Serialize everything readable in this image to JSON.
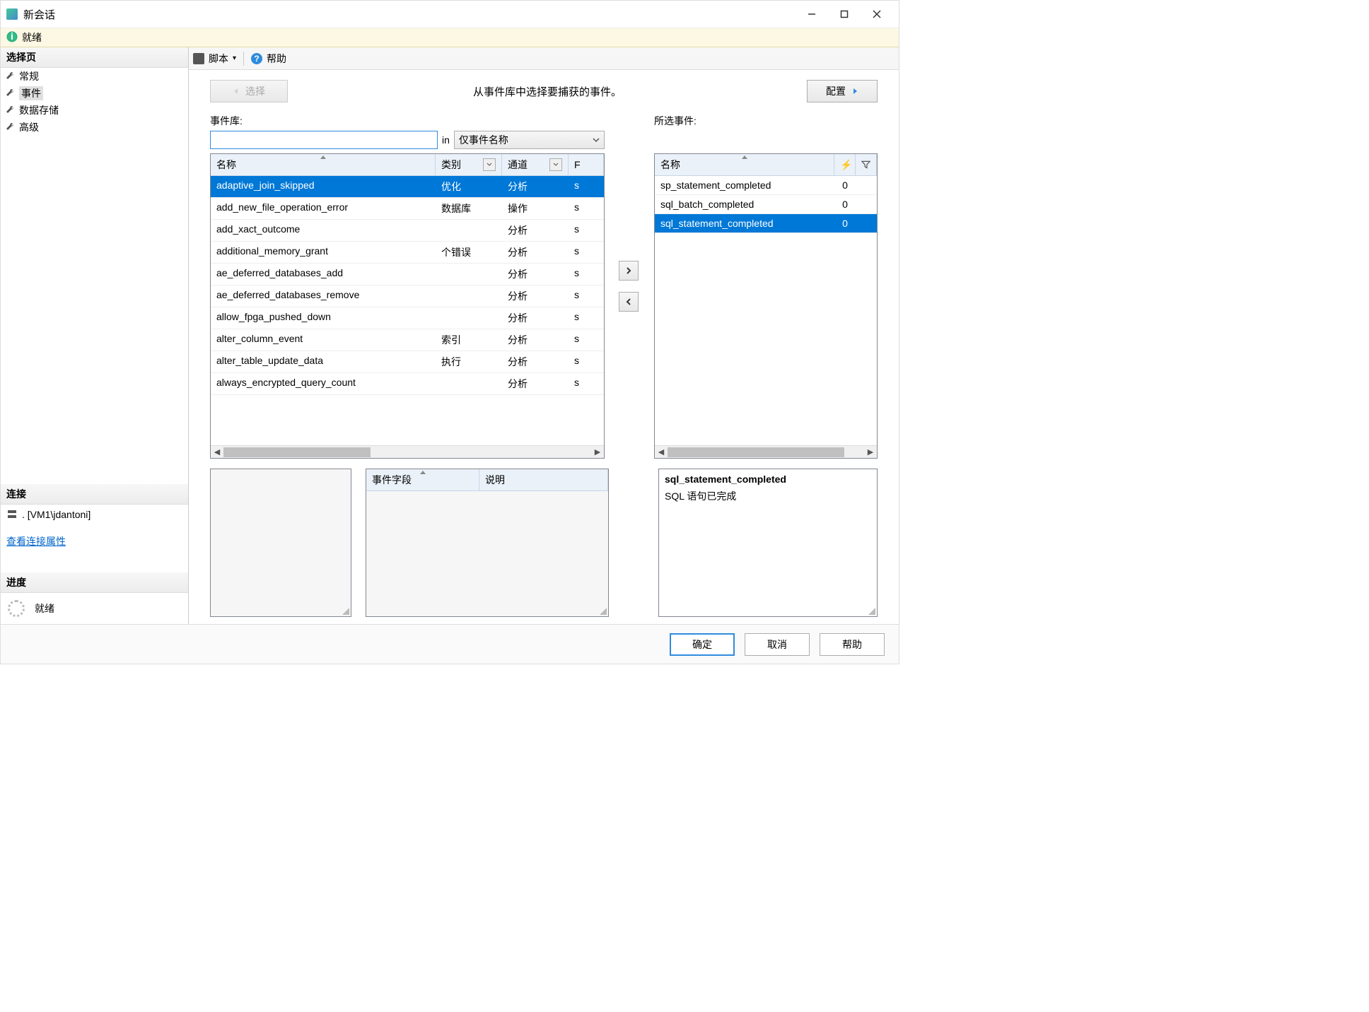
{
  "window": {
    "title": "新会话"
  },
  "statusbar": {
    "text": "就绪"
  },
  "leftnav": {
    "select_page": "选择页",
    "items": [
      {
        "label": "常规"
      },
      {
        "label": "事件"
      },
      {
        "label": "数据存储"
      },
      {
        "label": "高级"
      }
    ],
    "connection": "连接",
    "connection_value": ". [VM1\\jdantoni]",
    "view_conn_props": "查看连接属性",
    "progress": "进度",
    "progress_text": "就绪"
  },
  "toolbar": {
    "script": "脚本",
    "dropdown": "▾",
    "help": "帮助"
  },
  "main": {
    "select_btn": "选择",
    "instruction": "从事件库中选择要捕获的事件。",
    "config_btn": "配置",
    "event_lib": "事件库:",
    "search_value": "",
    "in_label": "in",
    "combo_value": "仅事件名称",
    "lib_cols": {
      "name": "名称",
      "category": "类别",
      "channel": "通道",
      "extra": "F"
    },
    "lib_rows": [
      {
        "name": "adaptive_join_skipped",
        "category": "优化",
        "channel": "分析",
        "extra": "s"
      },
      {
        "name": "add_new_file_operation_error",
        "category": "数据库",
        "channel": "操作",
        "extra": "s"
      },
      {
        "name": "add_xact_outcome",
        "category": "",
        "channel": "分析",
        "extra": "s"
      },
      {
        "name": "additional_memory_grant",
        "category": "个错误",
        "channel": "分析",
        "extra": "s"
      },
      {
        "name": "ae_deferred_databases_add",
        "category": "",
        "channel": "分析",
        "extra": "s"
      },
      {
        "name": "ae_deferred_databases_remove",
        "category": "",
        "channel": "分析",
        "extra": "s"
      },
      {
        "name": "allow_fpga_pushed_down",
        "category": "",
        "channel": "分析",
        "extra": "s"
      },
      {
        "name": "alter_column_event",
        "category": "索引",
        "channel": "分析",
        "extra": "s"
      },
      {
        "name": "alter_table_update_data",
        "category": "执行",
        "channel": "分析",
        "extra": "s"
      },
      {
        "name": "always_encrypted_query_count",
        "category": "",
        "channel": "分析",
        "extra": "s"
      }
    ],
    "selected_label": "所选事件:",
    "sel_cols": {
      "name": "名称"
    },
    "sel_rows": [
      {
        "name": "sp_statement_completed",
        "count": "0"
      },
      {
        "name": "sql_batch_completed",
        "count": "0"
      },
      {
        "name": "sql_statement_completed",
        "count": "0"
      }
    ],
    "field_cols": {
      "field": "事件字段",
      "desc": "说明"
    },
    "detail": {
      "title": "sql_statement_completed",
      "desc": "SQL 语句已完成"
    }
  },
  "footer": {
    "ok": "确定",
    "cancel": "取消",
    "help": "帮助"
  }
}
